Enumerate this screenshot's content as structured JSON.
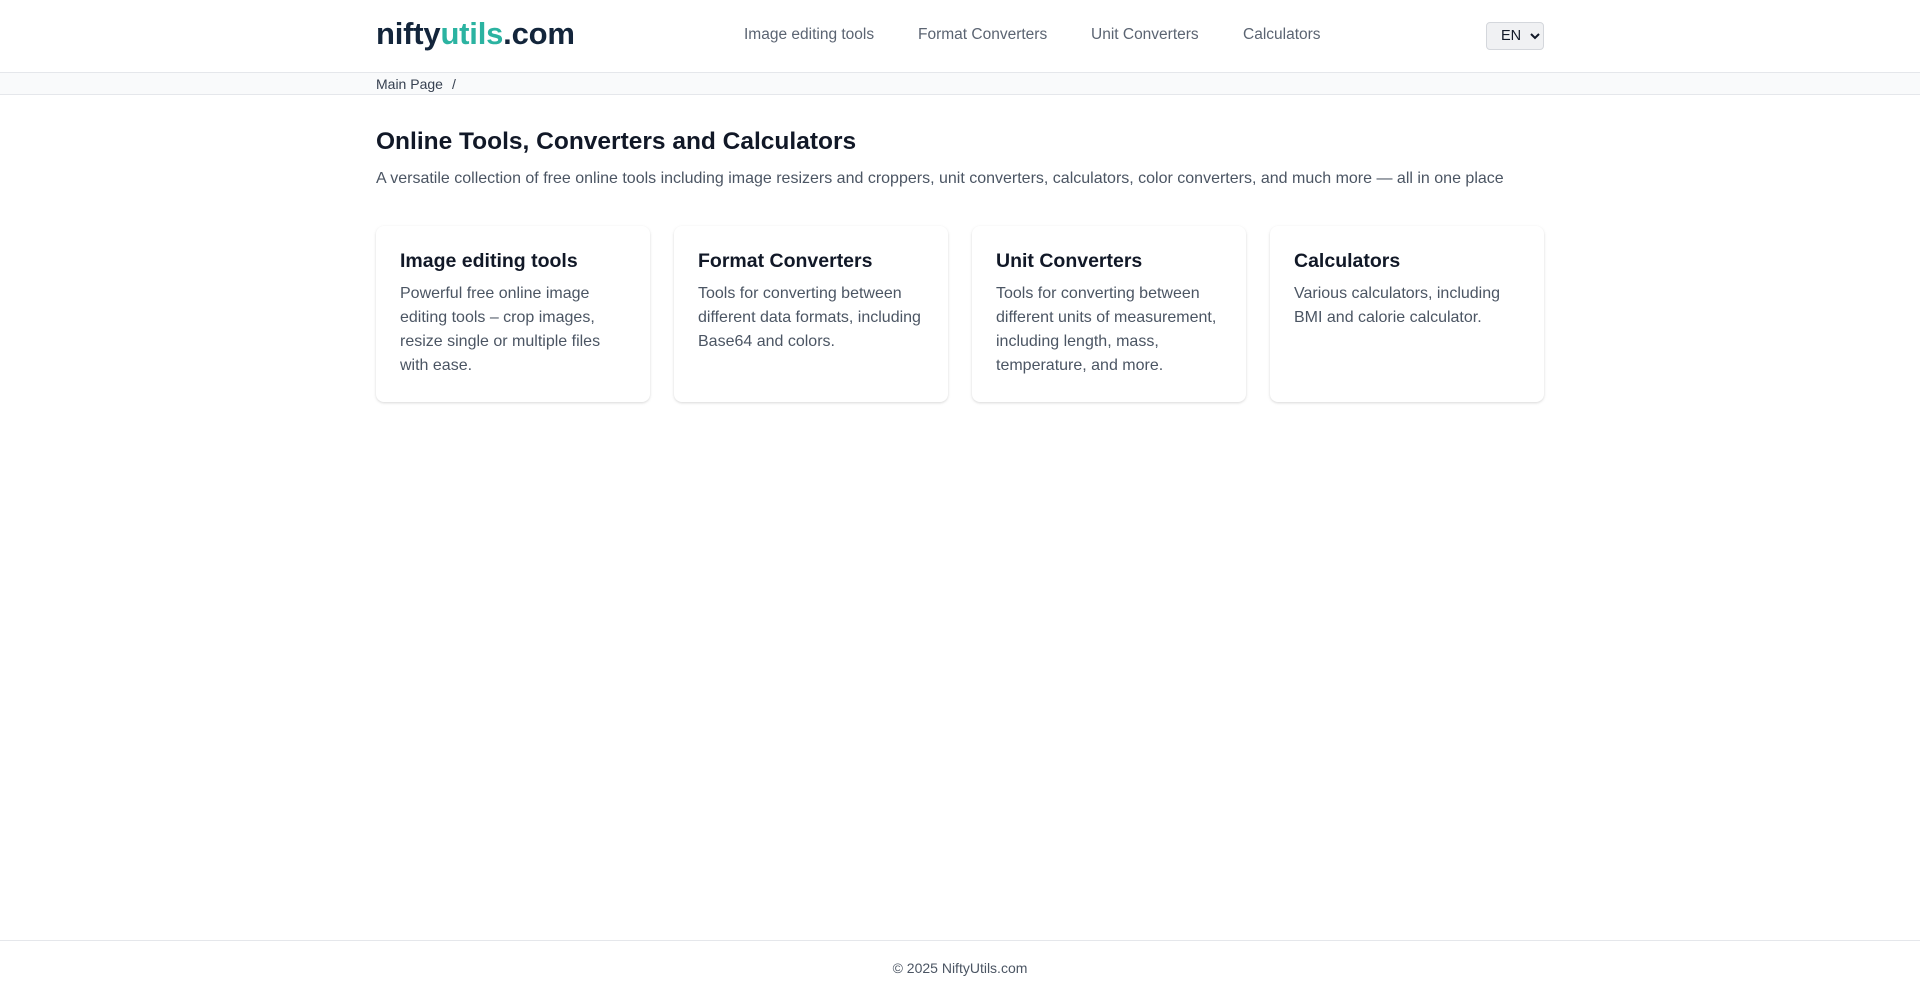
{
  "header": {
    "logo": {
      "part1": "nifty",
      "part2": "utils",
      "part3": ".com"
    },
    "nav": [
      {
        "label": "Image editing tools"
      },
      {
        "label": "Format Converters"
      },
      {
        "label": "Unit Converters"
      },
      {
        "label": "Calculators"
      }
    ],
    "language": {
      "selected": "EN"
    }
  },
  "breadcrumb": {
    "items": [
      {
        "label": "Main Page"
      }
    ],
    "separator": "/"
  },
  "main": {
    "title": "Online Tools, Converters and Calculators",
    "subtitle": "A versatile collection of free online tools including image resizers and croppers, unit converters, calculators, color converters, and much more — all in one place",
    "cards": [
      {
        "title": "Image editing tools",
        "description": "Powerful free online image editing tools – crop images, resize single or multiple files with ease."
      },
      {
        "title": "Format Converters",
        "description": "Tools for converting between different data formats, including Base64 and colors."
      },
      {
        "title": "Unit Converters",
        "description": "Tools for converting between different units of measurement, including length, mass, temperature, and more."
      },
      {
        "title": "Calculators",
        "description": "Various calculators, including BMI and calorie calculator."
      }
    ]
  },
  "footer": {
    "text": "© 2025 NiftyUtils.com"
  },
  "colors": {
    "logo_dark": "#13253b",
    "logo_accent": "#2bb3a1",
    "nav_text": "#5b6472",
    "body_text": "#4b5563",
    "heading_text": "#111827"
  }
}
